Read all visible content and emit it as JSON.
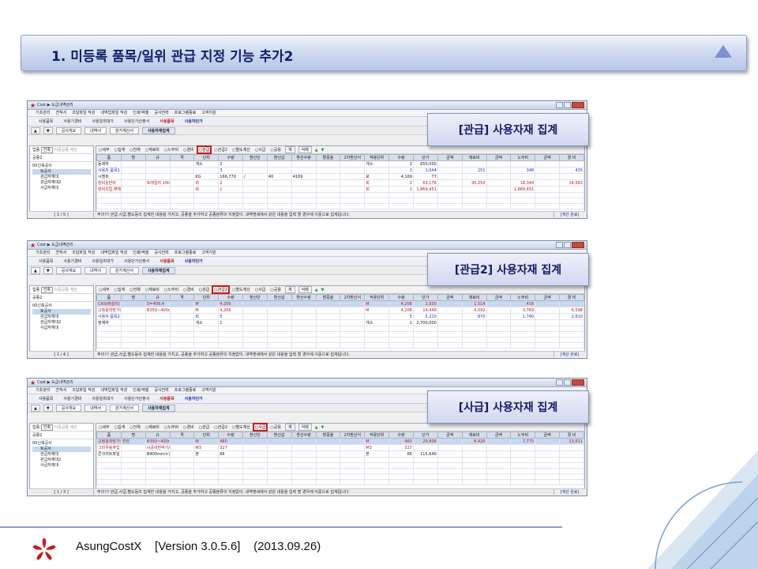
{
  "title": "1. 미등록 품목/일위 관급 지정 기능 추가2",
  "windows": [
    {
      "callout": "[관급] 사용자재 집계",
      "status_page": "[ 1 / 5 ]"
    },
    {
      "callout": "[관급2] 사용자재 집계",
      "status_page": "[ 1 / 4 ]"
    },
    {
      "callout": "[사급] 사용자재 집계",
      "status_page": "[ 1 / 3 ]"
    }
  ],
  "common": {
    "window_title": "Cost ▶ 도급내역관리",
    "menu": [
      "기초관리",
      "견적서",
      "조달파일 작성",
      "내역업파일 작성",
      "인쇄/엑셀",
      "공사전력",
      "프로그램종료",
      "고객지원"
    ],
    "tools": [
      "사용품목",
      "사용기경비",
      "사용일위대가",
      "사용단가산출서"
    ],
    "tool_red": "사용품목",
    "tool_blue": "사용자단가",
    "tabs": [
      "공사개요",
      "내역서",
      "원가계산서",
      "사용자재집계"
    ],
    "up": "업종",
    "up_val": "건축",
    "gong": "공종2",
    "dajung": "다중공종 계산",
    "filters": [
      "세부",
      "집계",
      "전체",
      "재료비",
      "노무비",
      "경비",
      "관급",
      "관급2",
      "별도계산",
      "사급",
      "공용"
    ],
    "btn_gye": "계",
    "btn_sakje": "삭제",
    "tree": [
      "00신축공사",
      "토공사",
      "관급자재대",
      "관급자재대2",
      "사급자재대"
    ],
    "headers": [
      "품",
      "명",
      "규",
      "격",
      "단위",
      "수량",
      "환산단",
      "환산값",
      "환산수량",
      "할증율",
      "2차환산식",
      "적용단위",
      "수량",
      "단가",
      "금액",
      "재료비",
      "금액",
      "노무비",
      "금액",
      "경 비",
      "금액",
      "비"
    ],
    "calc": "[계산 완료]"
  },
  "grid1": [
    [
      "동재하",
      "",
      "",
      "",
      "개소",
      "2",
      "",
      "",
      "",
      "",
      "",
      "개소",
      "2",
      "650,000",
      "",
      "",
      "",
      "",
      "",
      ""
    ],
    [
      "사용자 품목1",
      "",
      "",
      "",
      "",
      "3",
      "",
      "",
      "",
      "",
      "",
      "",
      "3",
      "1,044",
      "",
      "251",
      "",
      "348",
      "",
      "435"
    ],
    [
      "시멘트",
      "",
      "",
      "",
      "KG",
      "166,770",
      "/",
      "40",
      "4169",
      "",
      "",
      "포",
      "4,169",
      "77",
      "",
      "",
      "",
      "",
      "",
      ""
    ],
    [
      "장비운반비",
      "",
      "트레일러 20ton",
      "",
      "회",
      "2",
      "",
      "",
      "",
      "",
      "",
      "회",
      "2",
      "63,176",
      "",
      "30,250",
      "",
      "18,344",
      "",
      "14,582"
    ],
    [
      "장비조립,해체",
      "",
      "",
      "",
      "회",
      "1",
      "",
      "",
      "",
      "",
      "",
      "회",
      "1",
      "1,869,451",
      "",
      "",
      "",
      "1,869,451",
      "",
      ""
    ]
  ],
  "grid2": [
    [
      "CAS(배설치)",
      "",
      "D=406.4",
      "",
      "M",
      "4,206",
      "",
      "",
      "",
      "",
      "",
      "M",
      "4,206",
      "1,930",
      "",
      "1,514",
      "",
      "416",
      "",
      ""
    ],
    [
      "고정용학망가집말박기(S) 토사",
      "",
      "Φ350~400mm",
      "",
      "M",
      "4,206",
      "",
      "",
      "",
      "",
      "",
      "M",
      "4,206",
      "14,449",
      "",
      "4,092",
      "",
      "3,769",
      "",
      "6,598"
    ],
    [
      "사용자 품목2",
      "",
      "",
      "",
      "회",
      "5",
      "",
      "",
      "",
      "",
      "",
      "",
      "5",
      "5,220",
      "",
      "870",
      "",
      "1,740",
      "",
      "2,610"
    ],
    [
      "정재하",
      "",
      "",
      "",
      "개소",
      "1",
      "",
      "",
      "",
      "",
      "",
      "개소",
      "1",
      "2,700,000",
      "",
      "",
      "",
      "",
      "",
      ""
    ]
  ],
  "grid3": [
    [
      "고정용학망가집말박기(S)",
      "연암",
      "Φ350~400mm",
      "",
      "M",
      "460",
      "",
      "",
      "",
      "",
      "",
      "M",
      "460",
      "29,806",
      "",
      "8,420",
      "",
      "7,775",
      "",
      "13,611"
    ],
    [
      "그라우팅주입",
      "",
      "시공비반박기/유포함",
      "",
      "M3",
      "327",
      "",
      "",
      "",
      "",
      "",
      "M3",
      "327",
      "",
      "",
      "",
      "",
      "",
      "",
      ""
    ],
    [
      "콘크리트파일",
      "",
      "Φ400mm×7m",
      "",
      "본",
      "66",
      "",
      "",
      "",
      "",
      "",
      "본",
      "66",
      "115,640",
      "",
      "",
      "",
      "",
      "",
      ""
    ]
  ],
  "status_msg1": "주의!!! 관급,사급,별도등의 집계한 내용을 가지고, 공종을 추가하고 공종분류의 지정없이. 내역명세에서 같은 내용을 입력 할 경우에 이중으로 집계됩니다.",
  "footer": "AsungCostX    [Version 3.0.5.6]    (2013.09.26)",
  "colors": {
    "title_text": "#10206a",
    "callout_text": "#16186a",
    "highlight": "#e01010"
  }
}
